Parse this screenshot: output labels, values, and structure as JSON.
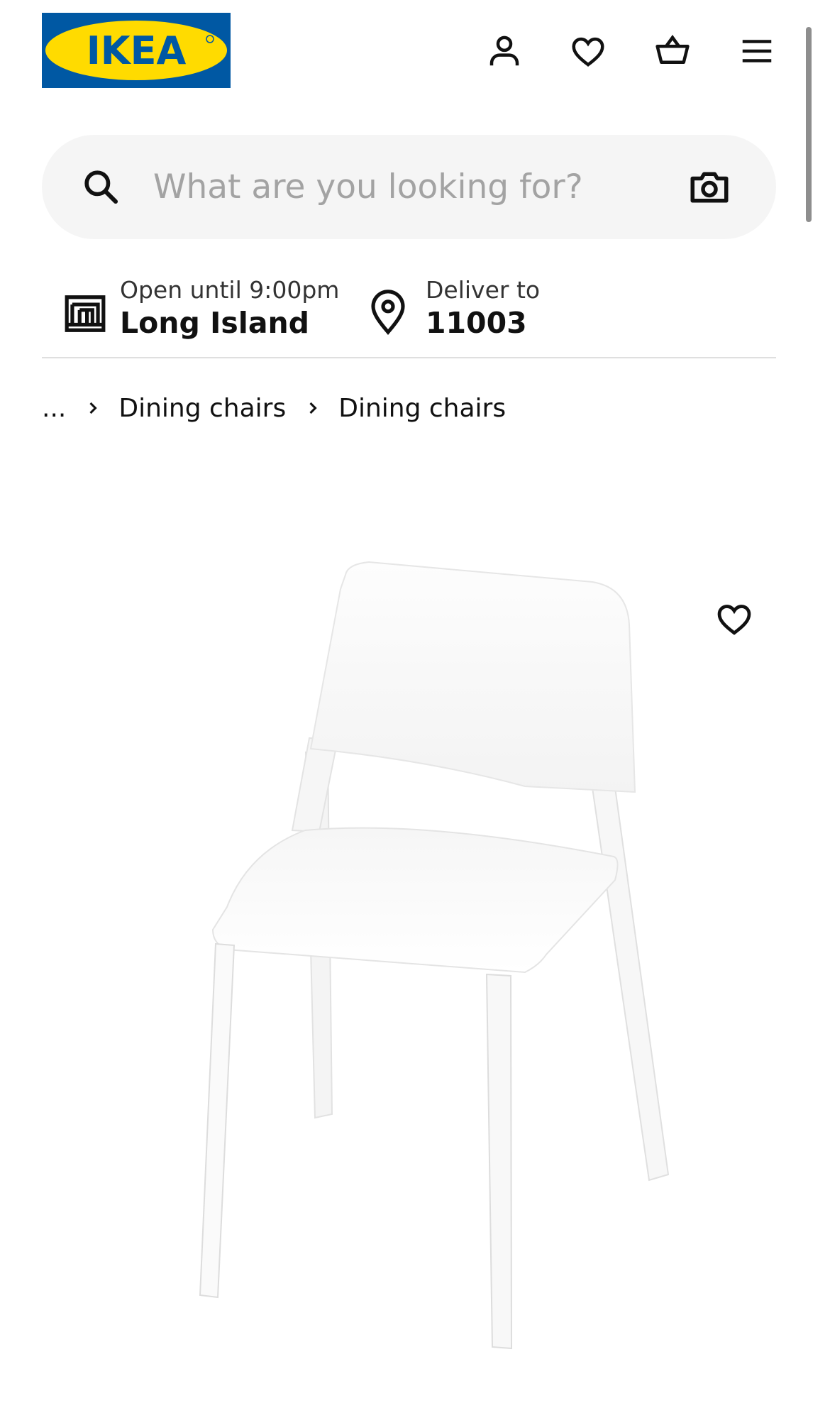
{
  "header": {
    "logo_text": "IKEA",
    "icons": [
      "account-icon",
      "heart-icon",
      "basket-icon",
      "menu-icon"
    ]
  },
  "search": {
    "placeholder": "What are you looking for?",
    "value": ""
  },
  "store": {
    "status": "Open until 9:00pm",
    "name": "Long Island"
  },
  "delivery": {
    "label": "Deliver to",
    "zip": "11003"
  },
  "breadcrumb": {
    "ellipsis": "...",
    "items": [
      "Dining chairs",
      "Dining chairs"
    ]
  },
  "colors": {
    "brand_blue": "#0058a3",
    "brand_yellow": "#ffdb00",
    "search_bg": "#f5f5f5",
    "divider": "#dfdfdf"
  }
}
